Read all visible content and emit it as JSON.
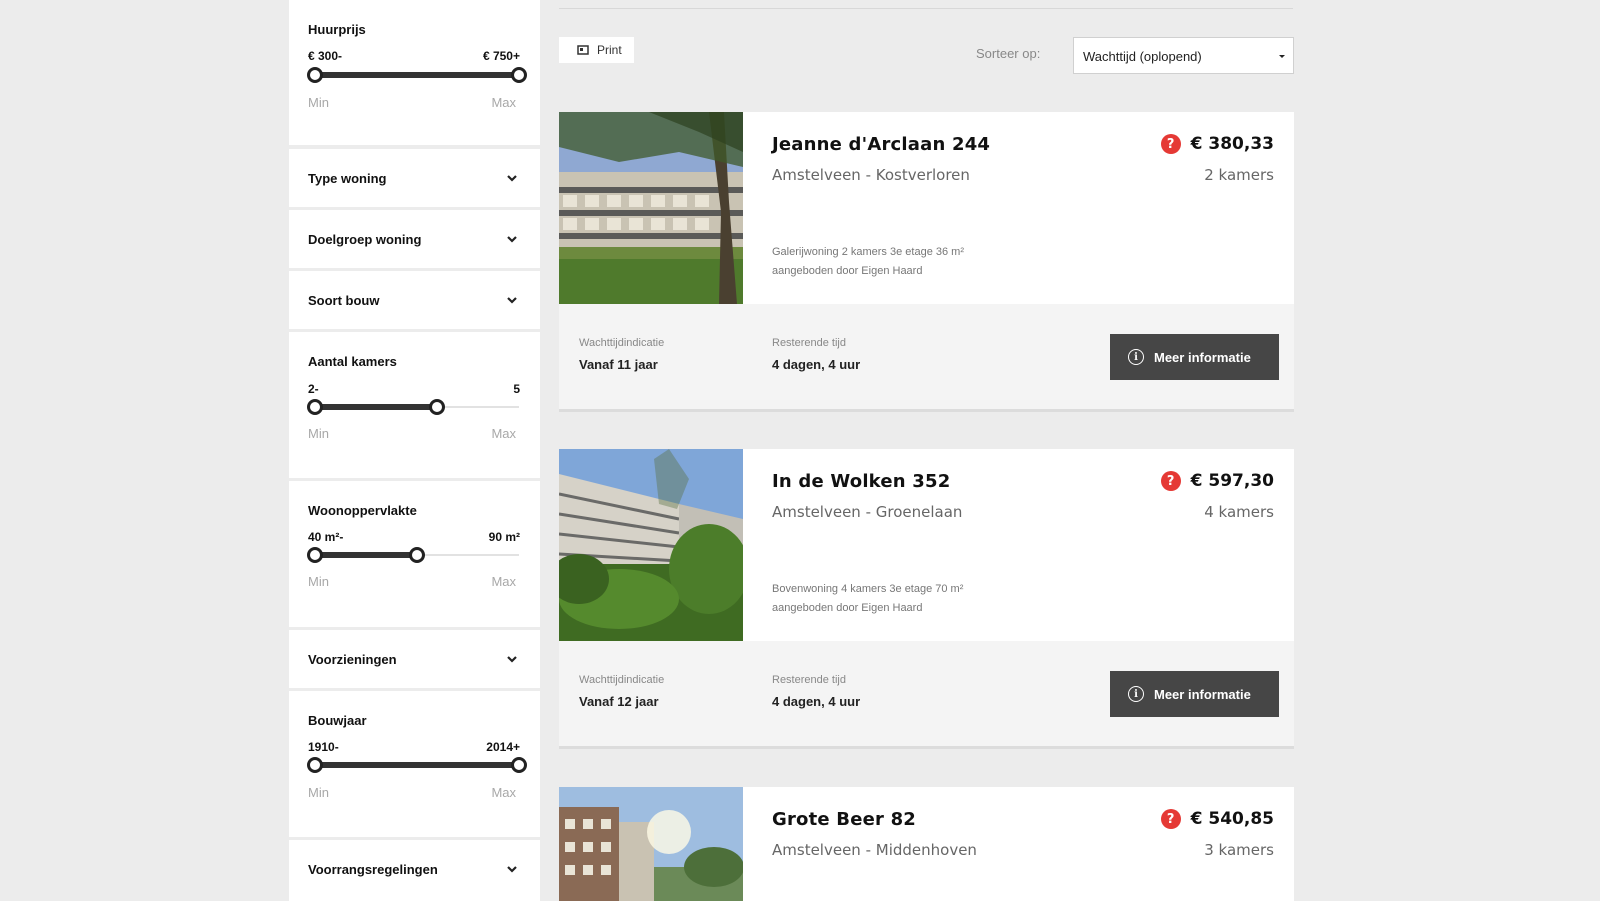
{
  "filters": {
    "huurprijs": {
      "title": "Huurprijs",
      "min_label": "€ 300-",
      "max_label": "€ 750+",
      "min_word": "Min",
      "max_word": "Max",
      "low_frac": 0.0,
      "high_frac": 1.0
    },
    "type_woning": {
      "title": "Type woning"
    },
    "doelgroep": {
      "title": "Doelgroep woning"
    },
    "soort_bouw": {
      "title": "Soort bouw"
    },
    "kamers": {
      "title": "Aantal kamers",
      "min_label": "2-",
      "max_label": "5",
      "min_word": "Min",
      "max_word": "Max",
      "low_frac": 0.0,
      "high_frac": 0.6
    },
    "oppervlakte": {
      "title": "Woonoppervlakte",
      "min_label": "40 m²-",
      "max_label": "90 m²",
      "min_word": "Min",
      "max_word": "Max",
      "low_frac": 0.0,
      "high_frac": 0.5
    },
    "voorzieningen": {
      "title": "Voorzieningen"
    },
    "bouwjaar": {
      "title": "Bouwjaar",
      "min_label": "1910-",
      "max_label": "2014+",
      "min_word": "Min",
      "max_word": "Max",
      "low_frac": 0.0,
      "high_frac": 1.0
    },
    "voorrang": {
      "title": "Voorrangsregelingen"
    }
  },
  "toolbar": {
    "print_label": "Print",
    "sort_label": "Sorteer op:",
    "sort_value": "Wachttijd (oplopend)"
  },
  "listings": [
    {
      "title": "Jeanne d'Arclaan 244",
      "location": "Amstelveen - Kostverloren",
      "price": "€ 380,33",
      "rooms": "2 kamers",
      "desc_line1": "Galerijwoning 2 kamers 3e etage 36 m²",
      "desc_line2": "aangeboden door Eigen Haard",
      "wait_label": "Wachttijdindicatie",
      "wait_value": "Vanaf 11 jaar",
      "remaining_label": "Resterende tijd",
      "remaining_value": "4 dagen, 4 uur",
      "more_label": "Meer informatie"
    },
    {
      "title": "In de Wolken 352",
      "location": "Amstelveen - Groenelaan",
      "price": "€ 597,30",
      "rooms": "4 kamers",
      "desc_line1": "Bovenwoning 4 kamers 3e etage 70 m²",
      "desc_line2": "aangeboden door Eigen Haard",
      "wait_label": "Wachttijdindicatie",
      "wait_value": "Vanaf 12 jaar",
      "remaining_label": "Resterende tijd",
      "remaining_value": "4 dagen, 4 uur",
      "more_label": "Meer informatie"
    },
    {
      "title": "Grote Beer 82",
      "location": "Amstelveen - Middenhoven",
      "price": "€ 540,85",
      "rooms": "3 kamers"
    }
  ],
  "colors": {
    "accent_red": "#e53935",
    "button_dark": "#464646"
  },
  "icons": {
    "print": "print-icon",
    "info": "info-icon",
    "help": "question-icon",
    "chevron": "chevron-down-icon"
  }
}
